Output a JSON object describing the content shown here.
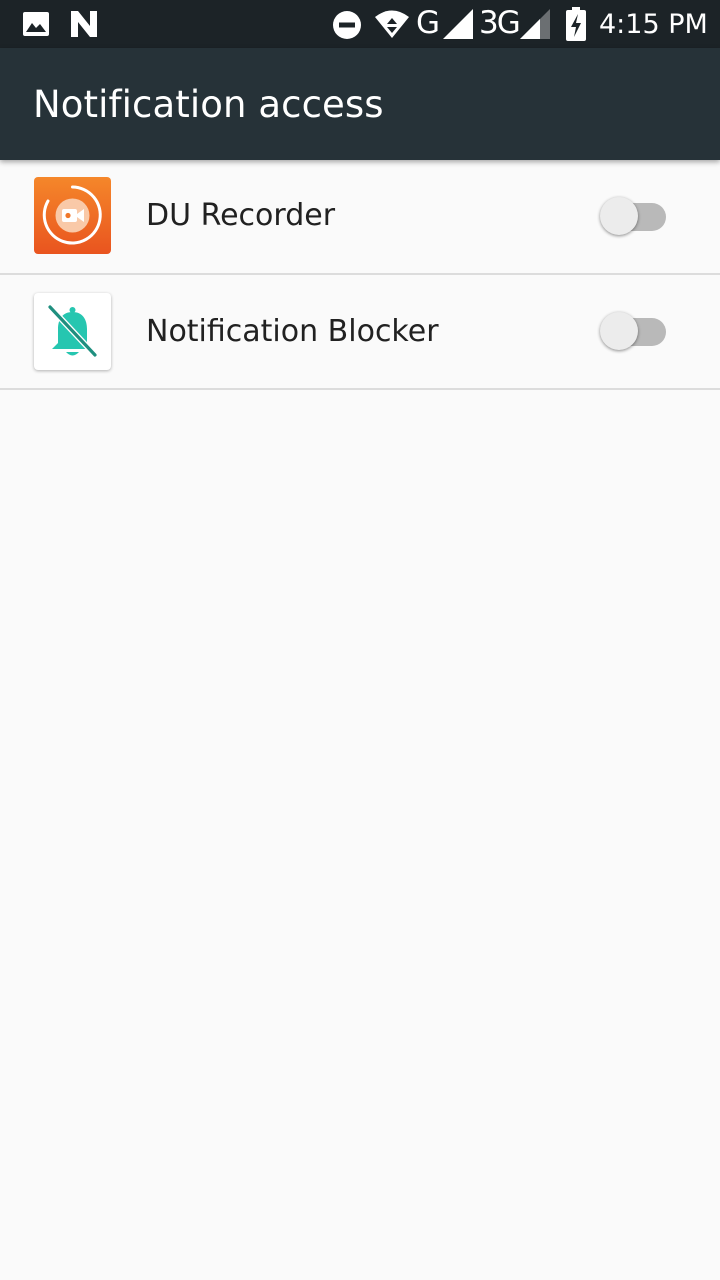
{
  "status_bar": {
    "network_g": "G",
    "network_3g": "3G",
    "time": "4:15 PM",
    "icons": [
      "image-icon",
      "n-icon",
      "dnd-icon",
      "wifi-icon",
      "signal-icon",
      "signal-icon-2",
      "battery-charging-icon"
    ]
  },
  "app_bar": {
    "title": "Notification access"
  },
  "list": {
    "items": [
      {
        "label": "DU Recorder",
        "icon": "du-recorder-icon",
        "enabled": false
      },
      {
        "label": "Notification Blocker",
        "icon": "notification-blocker-icon",
        "enabled": false
      }
    ]
  },
  "colors": {
    "status_bar": "#1c2327",
    "app_bar": "#263238",
    "background": "#fafafa",
    "du_recorder": "#ef6b22",
    "blocker_accent": "#26c6b0"
  }
}
